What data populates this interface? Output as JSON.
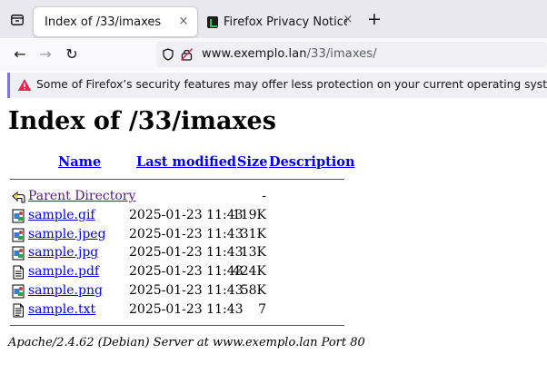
{
  "tabs": [
    {
      "title": "Index of /33/imaxes",
      "close": "×",
      "active": true
    },
    {
      "title": "Firefox Privacy Notice —",
      "close": "×",
      "active": false
    }
  ],
  "newtab_label": "+",
  "nav": {
    "back": "←",
    "forward": "→",
    "reload": "↻"
  },
  "url": {
    "host": "www.exemplo.lan",
    "path": "/33/imaxes/"
  },
  "infobar": {
    "message": "Some of Firefox’s security features may offer less protection on your current operating system."
  },
  "page": {
    "title": "Index of /33/imaxes",
    "headers": {
      "name": "Name",
      "modified": "Last modified",
      "size": "Size",
      "description": "Description"
    },
    "parent": {
      "name": "Parent Directory",
      "size": "-"
    },
    "files": [
      {
        "name": "sample.gif",
        "modified": "2025-01-23 11:43",
        "size": "119K",
        "icon": "image-icon"
      },
      {
        "name": "sample.jpeg",
        "modified": "2025-01-23 11:43",
        "size": "31K",
        "icon": "image-icon"
      },
      {
        "name": "sample.jpg",
        "modified": "2025-01-23 11:43",
        "size": "13K",
        "icon": "image-icon"
      },
      {
        "name": "sample.pdf",
        "modified": "2025-01-23 11:43",
        "size": "424K",
        "icon": "document-icon"
      },
      {
        "name": "sample.png",
        "modified": "2025-01-23 11:43",
        "size": "58K",
        "icon": "image-icon"
      },
      {
        "name": "sample.txt",
        "modified": "2025-01-23 11:43",
        "size": "7",
        "icon": "text-file-icon"
      }
    ],
    "address": "Apache/2.4.62 (Debian) Server at www.exemplo.lan Port 80"
  },
  "colors": {
    "link": "#0000ee",
    "visited": "#551a8b",
    "infobar_accent": "#7e78d9",
    "warning": "#e22850"
  }
}
